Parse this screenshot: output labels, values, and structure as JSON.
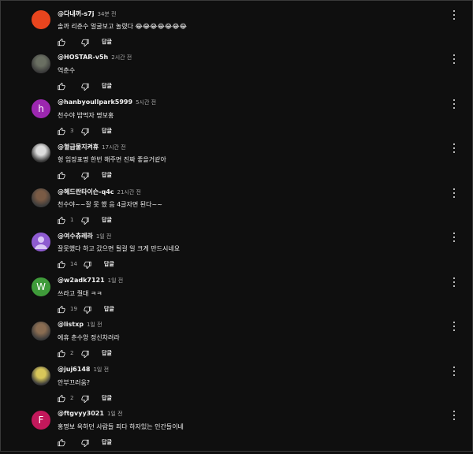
{
  "ui": {
    "reply_label": "답글"
  },
  "comments": [
    {
      "author": "@다내꺼-s7j",
      "time": "34분 전",
      "text": "솔까  리춘수 얼굴보고 놀렸다 😂😂😂😂😂😂😂",
      "likes": "",
      "avatar": {
        "type": "letter",
        "letter": "",
        "color": "#e8451e"
      }
    },
    {
      "author": "@HOSTAR-v5h",
      "time": "2시간 전",
      "text": "역춘수",
      "likes": "",
      "avatar": {
        "type": "photo",
        "color": "#6a6f62"
      }
    },
    {
      "author": "@hanbyoullpark5999",
      "time": "5시간 전",
      "text": "천수야 밥먹자 명보홍",
      "likes": "3",
      "avatar": {
        "type": "letter",
        "letter": "h",
        "color": "#9c27b0"
      }
    },
    {
      "author": "@혈급물지켜휴",
      "time": "17시간 전",
      "text": "형 임장표명 한번 해주면 진짜 좋을거같아",
      "likes": "",
      "avatar": {
        "type": "photo",
        "color": "#dcdcdc"
      }
    },
    {
      "author": "@헤드란타이슨-q4c",
      "time": "21시간 전",
      "text": "천수야~~잘 못 했 음 4글자면 된다~~",
      "likes": "1",
      "avatar": {
        "type": "photo",
        "color": "#7a5b45"
      }
    },
    {
      "author": "@여수츄레라",
      "time": "1일 전",
      "text": "잘못했다 하고 갔으면 될걸 일 크게 만드시네요",
      "likes": "14",
      "avatar": {
        "type": "person",
        "color": "#8e5bd1"
      }
    },
    {
      "author": "@w2adk7121",
      "time": "1일 전",
      "text": "쓰라고 줬대 ㅋㅋ",
      "likes": "19",
      "avatar": {
        "type": "letter",
        "letter": "W",
        "color": "#3f9b3a"
      }
    },
    {
      "author": "@listxp",
      "time": "1일 전",
      "text": "에휴 춘수앙 정신차려라",
      "likes": "2",
      "avatar": {
        "type": "photo",
        "color": "#8a6d52"
      }
    },
    {
      "author": "@juj6148",
      "time": "1일 전",
      "text": "안부끄러움?",
      "likes": "2",
      "avatar": {
        "type": "photo",
        "color": "#d8c75a"
      }
    },
    {
      "author": "@ftgvyy3021",
      "time": "1일 전",
      "text": "홍명보 욕하던 사람들 죄다 하자있는 인간들이네",
      "likes": "",
      "avatar": {
        "type": "letter",
        "letter": "F",
        "color": "#c2185b"
      }
    }
  ]
}
